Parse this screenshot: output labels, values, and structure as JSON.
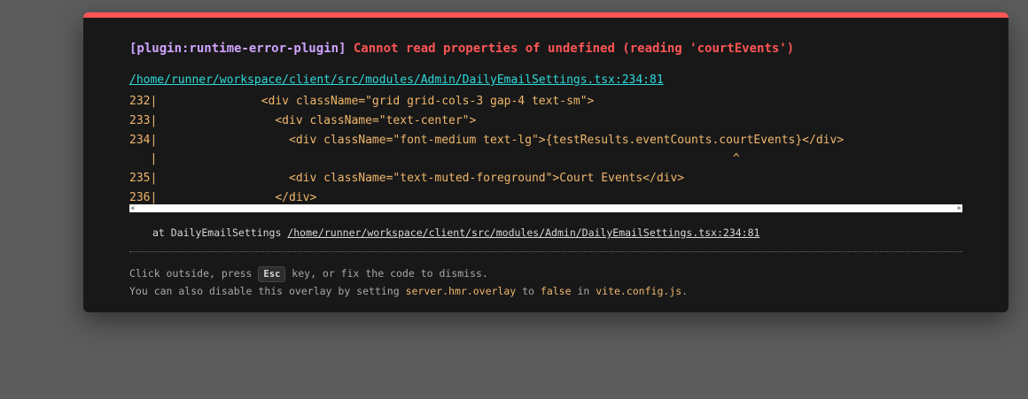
{
  "overlay": {
    "plugin_tag": "[plugin:runtime-error-plugin]",
    "message": "Cannot read properties of undefined (reading 'courtEvents')",
    "file_path": "/home/runner/workspace/client/src/modules/Admin/DailyEmailSettings.tsx:234:81",
    "code_lines": [
      "232|               <div className=\"grid grid-cols-3 gap-4 text-sm\">",
      "233|                 <div className=\"text-center\">",
      "234|                   <div className=\"font-medium text-lg\">{testResults.eventCounts.courtEvents}</div>",
      "   |                                                                                   ^",
      "235|                   <div className=\"text-muted-foreground\">Court Events</div>",
      "236|                 </div>"
    ],
    "scroll_left_arrow": "◀",
    "scroll_right_arrow": "▶",
    "stack_prefix": "at DailyEmailSettings ",
    "stack_file": "/home/runner/workspace/client/src/modules/Admin/DailyEmailSettings.tsx:234:81",
    "tip1_a": "Click outside, press ",
    "tip1_key": "Esc",
    "tip1_b": " key, or fix the code to dismiss.",
    "tip2_a": "You can also disable this overlay by setting ",
    "tip2_code1": "server.hmr.overlay",
    "tip2_b": " to ",
    "tip2_code2": "false",
    "tip2_c": " in ",
    "tip2_code3": "vite.config.js",
    "tip2_d": "."
  },
  "colors": {
    "accent_bar": "#ff5555",
    "plugin": "#cfa4ff",
    "link": "#2dd9da",
    "code": "#f0b66c"
  }
}
